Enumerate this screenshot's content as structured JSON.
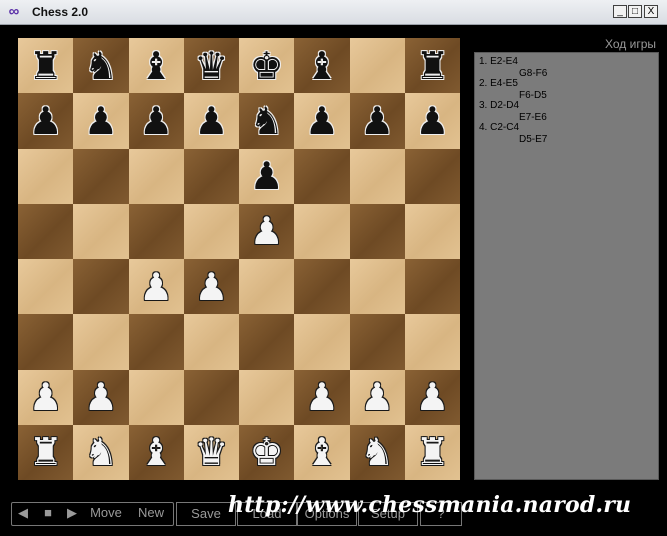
{
  "window": {
    "title": "Chess 2.0",
    "buttons": {
      "minimize": "_",
      "maximize": "□",
      "close": "X"
    }
  },
  "board": {
    "colors": {
      "light": "#d8b582",
      "dark": "#6e4a24"
    },
    "ranks": [
      [
        "bR",
        "bN",
        "bB",
        "bQ",
        "bK",
        "bB",
        "",
        ""
      ],
      [
        "bP",
        "bP",
        "bP",
        "bP",
        "bN",
        "bP",
        "bP",
        "bP"
      ],
      [
        "",
        "",
        "",
        "",
        "bP",
        "",
        "",
        ""
      ],
      [
        "",
        "",
        "",
        "",
        "wP",
        "",
        "",
        ""
      ],
      [
        "",
        "",
        "wP",
        "wP",
        "",
        "",
        "",
        ""
      ],
      [
        "",
        "",
        "",
        "",
        "",
        "",
        "",
        ""
      ],
      [
        "wP",
        "wP",
        "",
        "",
        "",
        "wP",
        "wP",
        "wP"
      ],
      [
        "wR",
        "wN",
        "wB",
        "wQ",
        "wK",
        "wB",
        "wN",
        "wR"
      ]
    ],
    "rank8_h": "bR"
  },
  "moves_panel": {
    "title": "Ход игры",
    "moves": [
      {
        "white": "1. E2-E4",
        "black": "G8-F6"
      },
      {
        "white": "2. E4-E5",
        "black": "F6-D5"
      },
      {
        "white": "3. D2-D4",
        "black": "E7-E6"
      },
      {
        "white": "4. C2-C4",
        "black": "D5-E7"
      }
    ]
  },
  "toolbar": {
    "prev_icon": "◀",
    "stop_icon": "■",
    "next_icon": "▶",
    "move": "Move",
    "new": "New",
    "save": "Save",
    "load": "Load",
    "options": "Options",
    "setup": "Setup",
    "help": "?"
  },
  "watermark": "http://www.chessmania.narod.ru"
}
